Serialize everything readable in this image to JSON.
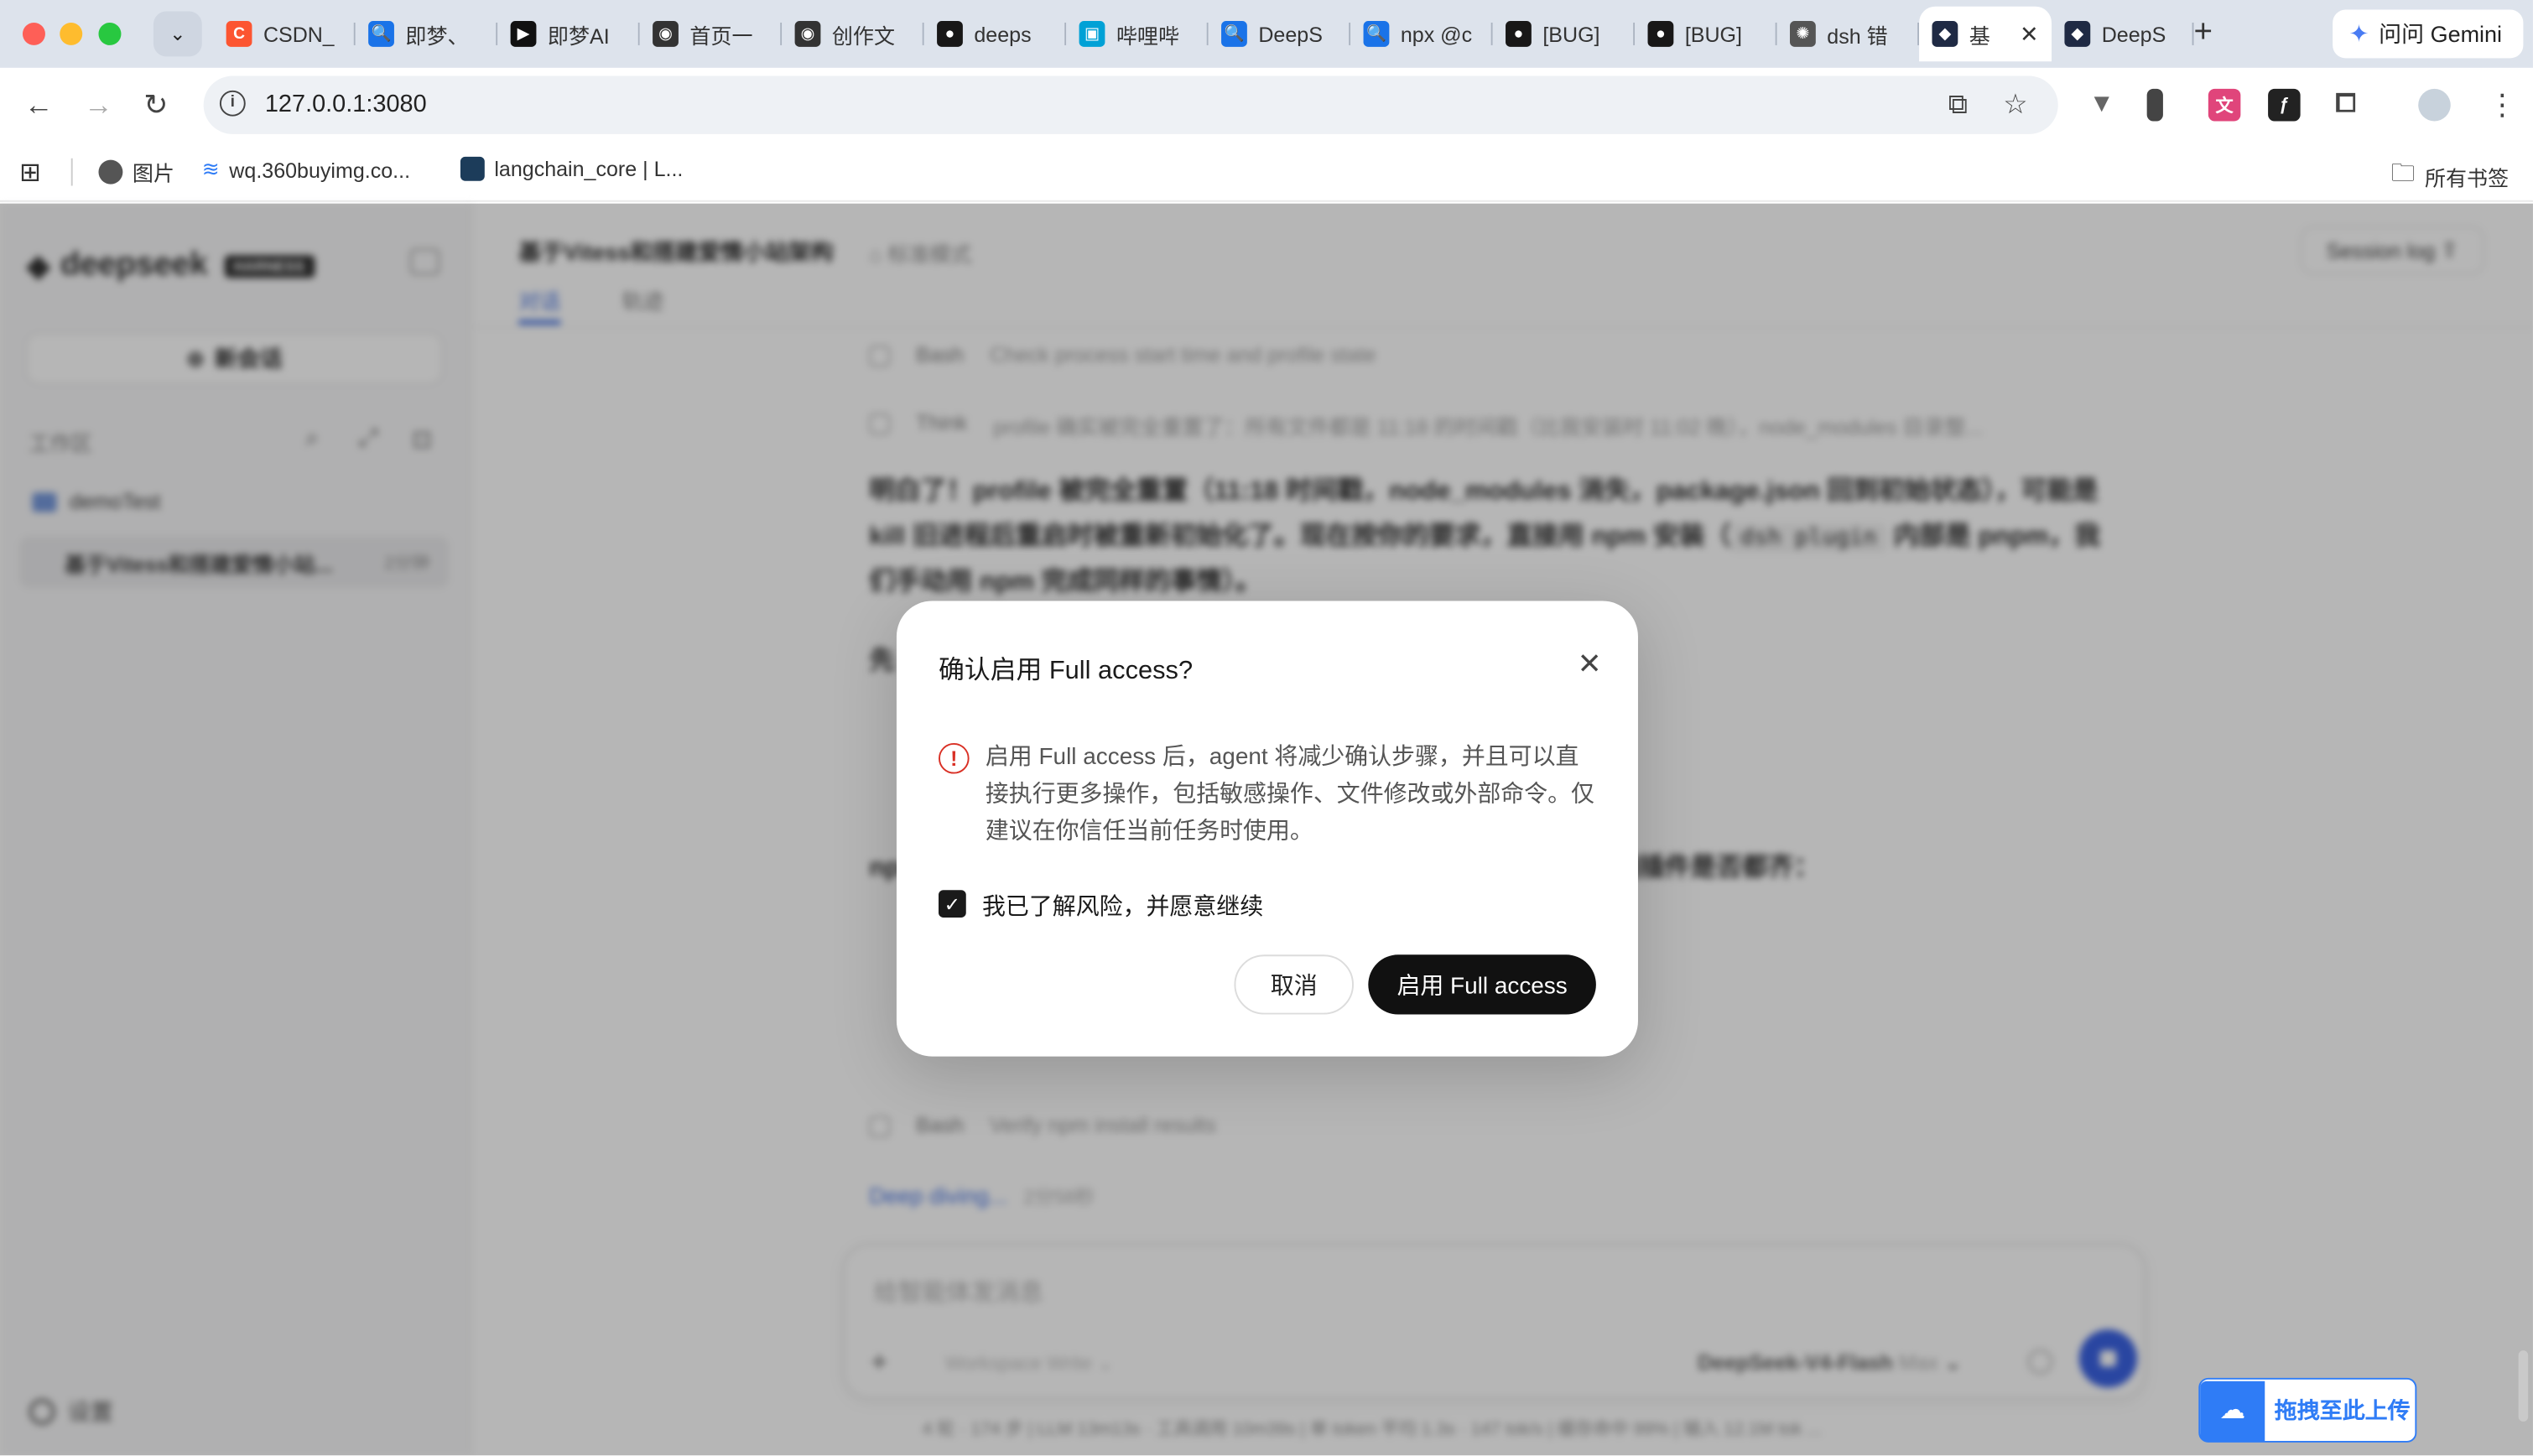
{
  "browser": {
    "tabs": [
      {
        "title": "CSDN_",
        "color": "#fc5531",
        "glyph": "C"
      },
      {
        "title": "即梦、",
        "color": "#1a73e8",
        "glyph": "🔍"
      },
      {
        "title": "即梦AI",
        "color": "#111111",
        "glyph": "▶"
      },
      {
        "title": "首页一",
        "color": "#333333",
        "glyph": "◉"
      },
      {
        "title": "创作文",
        "color": "#333333",
        "glyph": "◉"
      },
      {
        "title": "deeps",
        "color": "#181717",
        "glyph": "●"
      },
      {
        "title": "哔哩哔",
        "color": "#00a1d6",
        "glyph": "▣"
      },
      {
        "title": "DeepS",
        "color": "#1a73e8",
        "glyph": "🔍"
      },
      {
        "title": "npx @c",
        "color": "#1a73e8",
        "glyph": "🔍"
      },
      {
        "title": "[BUG]",
        "color": "#181717",
        "glyph": "●"
      },
      {
        "title": "[BUG]",
        "color": "#181717",
        "glyph": "●"
      },
      {
        "title": "dsh 错",
        "color": "#555555",
        "glyph": "✺"
      },
      {
        "title": "基",
        "color": "#1f2a44",
        "glyph": "◆",
        "active": true
      },
      {
        "title": "DeepS",
        "color": "#1f2a44",
        "glyph": "◆"
      }
    ],
    "gemini_label": "问问 Gemini",
    "url": "127.0.0.1:3080",
    "bookmarks": {
      "images": "图片",
      "wq": "wq.360buyimg.co...",
      "langchain": "langchain_core | L...",
      "all": "所有书签"
    }
  },
  "sidebar": {
    "logo": "deepseek",
    "logo_badge": "HARNESS",
    "new_chat": "新会话",
    "workspace_label": "工作区",
    "folder": "demoTest",
    "session_title": "基于Vitess和搭建爱情小站...",
    "session_time": "2分钟",
    "settings": "设置"
  },
  "main": {
    "project_title": "基于Vitess和搭建爱情小站架构",
    "mode": "标准模式",
    "tab_chat": "对话",
    "tab_trace": "轨迹",
    "session_log": "Session log",
    "steps": [
      {
        "tool": "Bash",
        "text": "Check process start time and profile state"
      },
      {
        "tool": "Think",
        "text": "profile 确实被完全重置了：所有文件都是 11:18 的时间戳（比我安装时 11:02 晚），node_modules 目录整..."
      },
      {
        "tool": "Bash",
        "text": "Verify npm install results"
      }
    ],
    "para1_a": "明白了！profile 被完全重置（11:18 时间戳，node_modules 消失，package.json 回到初始状态），可能是 kill 旧进程后重启时被重新初始化了。现在按你的要求，直接用 npm 安装（",
    "para1_code": "dsh plugin",
    "para1_b": " 内部是 pnpm，我们手动用 npm 完成同样的事情）。",
    "para2": "先",
    "para3": "npm 安装成功（98 个包），现在验证安装结果，并检查与 web 前端插件是否都齐：",
    "deep_dive": "Deep diving...",
    "deep_dive_time": "2分58秒",
    "composer_placeholder": "给智能体发消息",
    "composer_workspace": "Workspace Write",
    "composer_model": "DeepSeek-V4-Flash",
    "composer_level": "Max",
    "stats": "4 轮 · 174 步  |  LLM 13m13s · 工具调用 10m39s  |  单 token 平均 1.3s · 147 tok/s  |  缓存命中 99%  |  输入 12.1M tok ..."
  },
  "dialog": {
    "title": "确认启用 Full access?",
    "body": "启用 Full access 后，agent 将减少确认步骤，并且可以直接执行更多操作，包括敏感操作、文件修改或外部命令。仅建议在你信任当前任务时使用。",
    "checkbox_label": "我已了解风险，并愿意继续",
    "checkbox_checked": true,
    "cancel": "取消",
    "confirm": "启用 Full access"
  },
  "upload_widget": {
    "label": "拖拽至此上传"
  },
  "colors": {
    "primary": "#111111",
    "warning": "#d93025",
    "accent_blue": "#2f7cf6",
    "link_blue": "#3a6ae0"
  }
}
